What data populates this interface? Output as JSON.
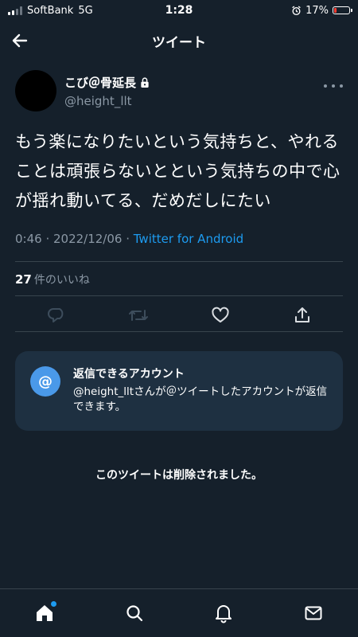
{
  "status_bar": {
    "carrier": "SoftBank",
    "network": "5G",
    "time": "1:28",
    "battery_percent": "17%",
    "battery_level": 0.17
  },
  "header": {
    "title": "ツイート"
  },
  "tweet": {
    "author_name": "こび＠骨延長",
    "author_handle": "@height_llt",
    "text": "もう楽になりたいという気持ちと、やれることは頑張らないとという気持ちの中で心が揺れ動いてる、だめだしにたい",
    "timestamp": "0:46 · 2022/12/06 · ",
    "source": "Twitter for Android",
    "likes_count": "27",
    "likes_label": "件のいいね"
  },
  "reply_notice": {
    "title": "返信できるアカウント",
    "body": "@height_lltさんが＠ツイートしたアカウントが返信できます。"
  },
  "deleted_notice": "このツイートは削除されました。",
  "colors": {
    "background": "#15202b",
    "accent": "#1d9bf0",
    "muted": "#8b98a5",
    "card": "#1e3041"
  },
  "icons": {
    "back": "arrow-left-icon",
    "reply": "reply-icon",
    "retweet": "retweet-icon",
    "like": "heart-icon",
    "share": "share-icon",
    "home": "home-icon",
    "search": "search-icon",
    "notifications": "bell-icon",
    "messages": "mail-icon"
  }
}
